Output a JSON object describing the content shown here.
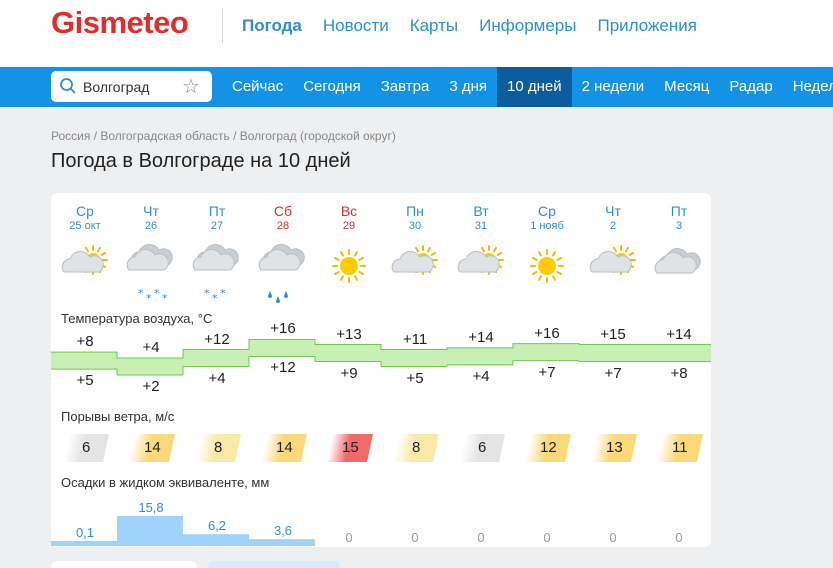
{
  "header": {
    "logo": "Gismeteo",
    "nav": [
      "Погода",
      "Новости",
      "Карты",
      "Информеры",
      "Приложения"
    ],
    "active_nav": 0
  },
  "bluebar": {
    "search_value": "Волгоград",
    "tabs": [
      "Сейчас",
      "Сегодня",
      "Завтра",
      "3 дня",
      "10 дней",
      "2 недели",
      "Месяц",
      "Радар",
      "Неделя"
    ],
    "active_tab": 4
  },
  "breadcrumb": [
    "Россия",
    "/",
    "Волгоградская область",
    "/",
    "Волгоград (городской округ)"
  ],
  "title": "Погода в Волгограде на 10 дней",
  "labels": {
    "temp": "Температура воздуха, °C",
    "wind": "Порывы ветра, м/с",
    "precip": "Осадки в жидком эквиваленте, мм"
  },
  "days": [
    {
      "name": "Ср",
      "date": "25 окт",
      "weekend": false,
      "icon": "partly-cloudy-icon",
      "max": "+8",
      "min": "+5",
      "gust": "6",
      "gust_level": "calm",
      "precip": "0,1",
      "precip_mm": 0.1
    },
    {
      "name": "Чт",
      "date": "26",
      "weekend": false,
      "icon": "cloudy-snow-icon",
      "max": "+4",
      "min": "+2",
      "gust": "14",
      "gust_level": "moderate",
      "precip": "15,8",
      "precip_mm": 15.8
    },
    {
      "name": "Пт",
      "date": "27",
      "weekend": false,
      "icon": "cloudy-light-snow-icon",
      "max": "+12",
      "min": "+4",
      "gust": "8",
      "gust_level": "light",
      "precip": "6,2",
      "precip_mm": 6.2
    },
    {
      "name": "Сб",
      "date": "28",
      "weekend": true,
      "icon": "cloudy-rain-icon",
      "max": "+16",
      "min": "+12",
      "gust": "14",
      "gust_level": "moderate",
      "precip": "3,6",
      "precip_mm": 3.6
    },
    {
      "name": "Вс",
      "date": "29",
      "weekend": true,
      "icon": "sun-icon",
      "max": "+13",
      "min": "+9",
      "gust": "15",
      "gust_level": "strong",
      "precip": "0",
      "precip_mm": 0
    },
    {
      "name": "Пн",
      "date": "30",
      "weekend": false,
      "icon": "partly-cloudy-icon",
      "max": "+11",
      "min": "+5",
      "gust": "8",
      "gust_level": "light",
      "precip": "0",
      "precip_mm": 0
    },
    {
      "name": "Вт",
      "date": "31",
      "weekend": false,
      "icon": "partly-cloudy-icon",
      "max": "+14",
      "min": "+4",
      "gust": "6",
      "gust_level": "calm",
      "precip": "0",
      "precip_mm": 0
    },
    {
      "name": "Ср",
      "date": "1 нояб",
      "weekend": false,
      "icon": "sun-icon",
      "max": "+16",
      "min": "+7",
      "gust": "12",
      "gust_level": "moderate",
      "precip": "0",
      "precip_mm": 0
    },
    {
      "name": "Чт",
      "date": "2",
      "weekend": false,
      "icon": "partly-cloudy-icon",
      "max": "+15",
      "min": "+7",
      "gust": "13",
      "gust_level": "moderate",
      "precip": "0",
      "precip_mm": 0
    },
    {
      "name": "Пт",
      "date": "3",
      "weekend": false,
      "icon": "cloudy-icon",
      "max": "+14",
      "min": "+8",
      "gust": "11",
      "gust_level": "moderate",
      "precip": "0",
      "precip_mm": 0
    }
  ],
  "colors": {
    "logo": "#e32b2b",
    "link": "#2f8dd8",
    "weekend": "#d32f2f",
    "bar": "#1493e6",
    "bar_active": "#0b5e9b",
    "temp_fill": "#c8f0b4",
    "temp_line": "#6cc94a",
    "precip_fill": "#9fd3fb",
    "gust_calm": "#e4e4e4",
    "gust_light": "#fbe9a8",
    "gust_moderate": "#fad97a",
    "gust_strong": "#f26b6b"
  }
}
